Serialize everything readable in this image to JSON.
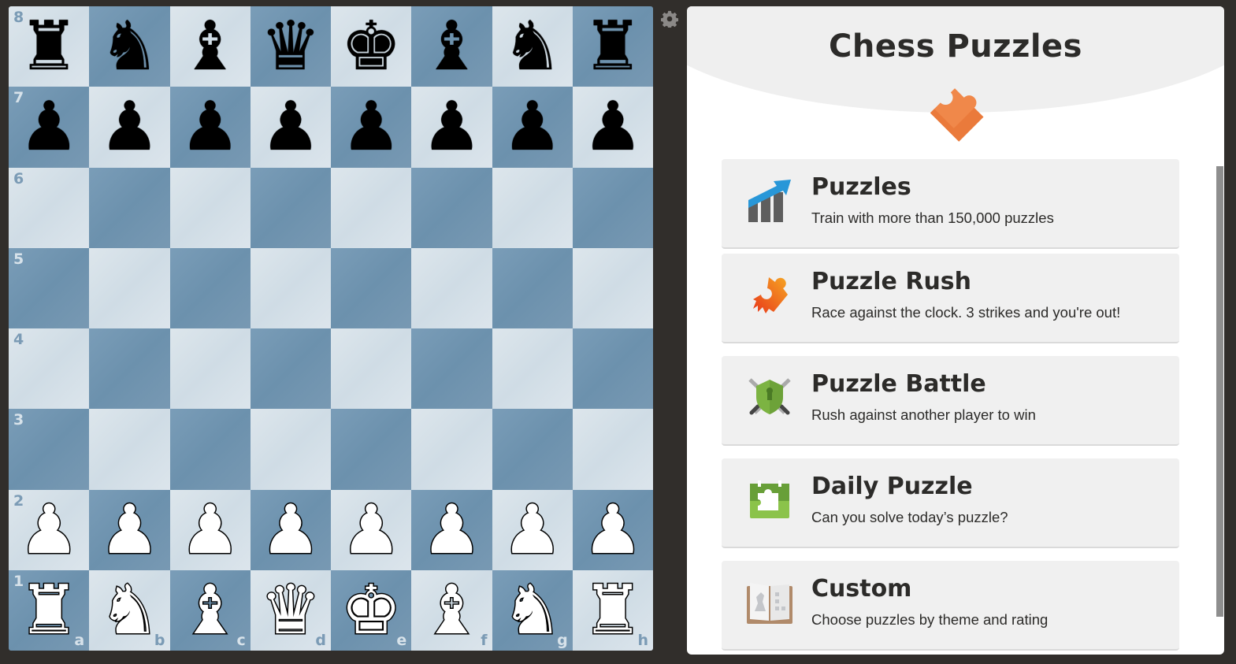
{
  "board": {
    "light_color": "#d5e0e8",
    "dark_color": "#7396b2",
    "ranks": [
      "8",
      "7",
      "6",
      "5",
      "4",
      "3",
      "2",
      "1"
    ],
    "files": [
      "a",
      "b",
      "c",
      "d",
      "e",
      "f",
      "g",
      "h"
    ],
    "position": [
      [
        "bR",
        "bN",
        "bB",
        "bQ",
        "bK",
        "bB",
        "bN",
        "bR"
      ],
      [
        "bP",
        "bP",
        "bP",
        "bP",
        "bP",
        "bP",
        "bP",
        "bP"
      ],
      [
        "",
        "",
        "",
        "",
        "",
        "",
        "",
        ""
      ],
      [
        "",
        "",
        "",
        "",
        "",
        "",
        "",
        ""
      ],
      [
        "",
        "",
        "",
        "",
        "",
        "",
        "",
        ""
      ],
      [
        "",
        "",
        "",
        "",
        "",
        "",
        "",
        ""
      ],
      [
        "wP",
        "wP",
        "wP",
        "wP",
        "wP",
        "wP",
        "wP",
        "wP"
      ],
      [
        "wR",
        "wN",
        "wB",
        "wQ",
        "wK",
        "wB",
        "wN",
        "wR"
      ]
    ],
    "piece_glyphs": {
      "K": "♚",
      "Q": "♛",
      "R": "♜",
      "B": "♝",
      "N": "♞",
      "P": "♟"
    }
  },
  "settings_icon": "gear-icon",
  "panel": {
    "title": "Chess Puzzles",
    "hero_icon": "puzzle-piece-icon",
    "accent": "#f0884a",
    "cards": [
      {
        "id": "puzzles",
        "icon": "chart-arrow-icon",
        "title": "Puzzles",
        "subtitle": "Train with more than 150,000 puzzles"
      },
      {
        "id": "puzzle-rush",
        "icon": "flaming-puzzle-icon",
        "title": "Puzzle Rush",
        "subtitle": "Race against the clock. 3 strikes and you're out!"
      },
      {
        "id": "puzzle-battle",
        "icon": "shield-swords-icon",
        "title": "Puzzle Battle",
        "subtitle": "Rush against another player to win"
      },
      {
        "id": "daily-puzzle",
        "icon": "calendar-puzzle-icon",
        "title": "Daily Puzzle",
        "subtitle": "Can you solve today’s puzzle?"
      },
      {
        "id": "custom",
        "icon": "book-icon",
        "title": "Custom",
        "subtitle": "Choose puzzles by theme and rating"
      }
    ]
  }
}
